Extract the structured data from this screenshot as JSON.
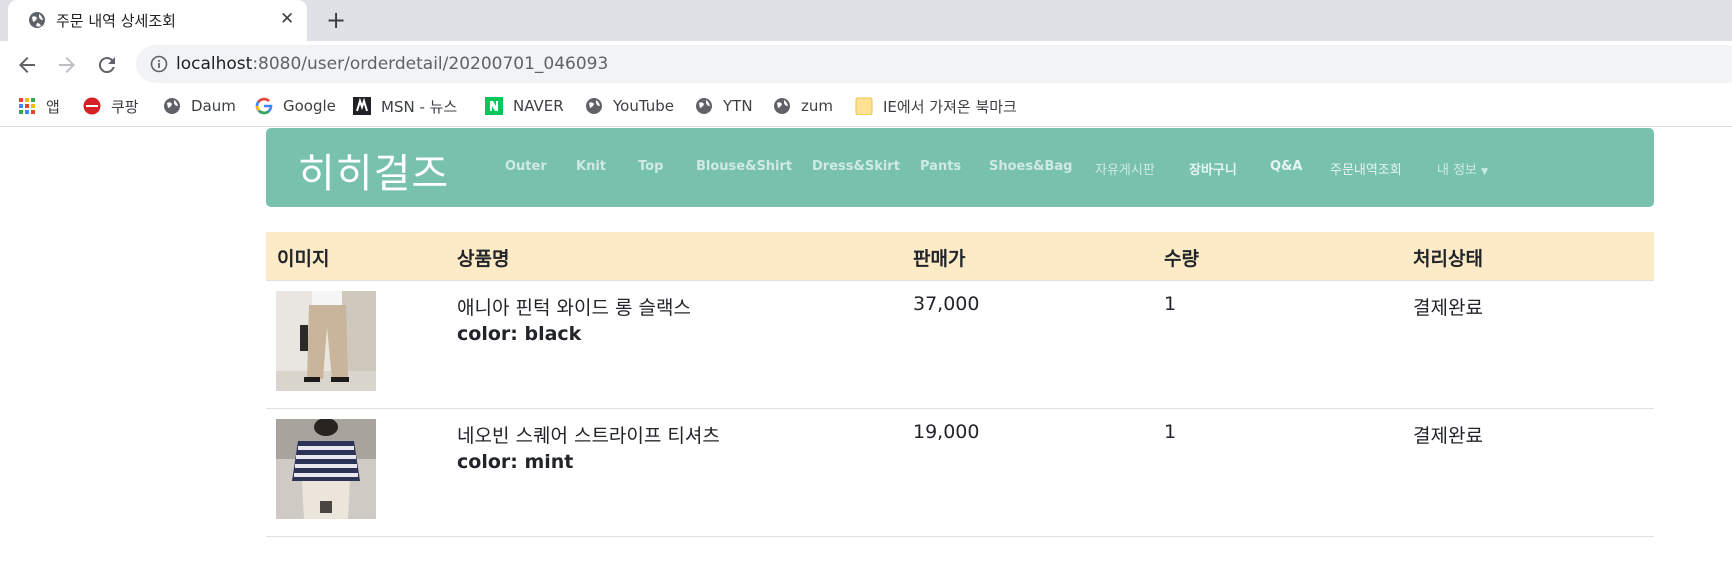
{
  "browser": {
    "tab_title": "주문 내역 상세조회",
    "url_host": "localhost",
    "url_rest": ":8080/user/orderdetail/20200701_046093",
    "bookmarks": [
      {
        "label": "앱",
        "icon": "apps-grid-icon"
      },
      {
        "label": "쿠팡",
        "icon": "coupang-icon"
      },
      {
        "label": "Daum",
        "icon": "globe-icon"
      },
      {
        "label": "Google",
        "icon": "google-icon"
      },
      {
        "label": "MSN - 뉴스",
        "icon": "msn-icon"
      },
      {
        "label": "NAVER",
        "icon": "naver-icon"
      },
      {
        "label": "YouTube",
        "icon": "globe-icon"
      },
      {
        "label": "YTN",
        "icon": "globe-icon"
      },
      {
        "label": "zum",
        "icon": "globe-icon"
      },
      {
        "label": "IE에서 가져온 북마크",
        "icon": "folder-icon"
      }
    ]
  },
  "site": {
    "brand": "히히걸즈",
    "nav": [
      {
        "label": "Outer"
      },
      {
        "label": "Knit"
      },
      {
        "label": "Top"
      },
      {
        "label": "Blouse&Shirt"
      },
      {
        "label": "Dress&Skirt"
      },
      {
        "label": "Pants"
      },
      {
        "label": "Shoes&Bag"
      },
      {
        "label": "자유게시판"
      },
      {
        "label": "장바구니"
      },
      {
        "label": "Q&A"
      },
      {
        "label": "주문내역조회"
      },
      {
        "label": "내 정보"
      }
    ]
  },
  "table": {
    "headers": [
      "이미지",
      "상품명",
      "판매가",
      "수량",
      "처리상태"
    ],
    "rows": [
      {
        "name": "애니아 핀턱 와이드 롱 슬랙스",
        "option": "color: black",
        "price": "37,000",
        "qty": "1",
        "status": "결제완료"
      },
      {
        "name": "네오빈 스퀘어 스트라이프 티셔츠",
        "option": "color: mint",
        "price": "19,000",
        "qty": "1",
        "status": "결제완료"
      }
    ]
  },
  "colors": {
    "navbar": "#78c2ad",
    "table_header": "#fcebc6"
  }
}
